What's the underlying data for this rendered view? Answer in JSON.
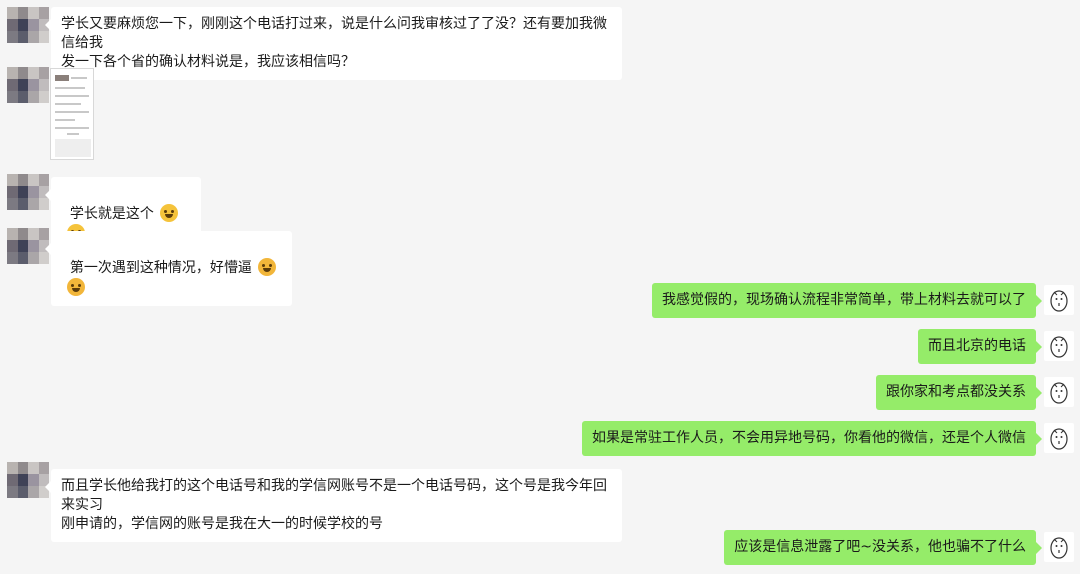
{
  "messages": [
    {
      "side": "in",
      "text": "学长又要麻烦您一下，刚刚这个电话打过来，说是什么问我审核过了了没？还有要加我微信给我\n发一下各个省的确认材料说是，我应该相信吗？"
    },
    {
      "side": "in",
      "type": "image"
    },
    {
      "side": "in",
      "text": "学长就是这个",
      "emoji": [
        "laugh-cry-emoji",
        "laugh-cry-emoji"
      ]
    },
    {
      "side": "in",
      "text": "第一次遇到这种情况，好懵逼",
      "emoji": [
        "facepalm-emoji",
        "facepalm-emoji"
      ]
    },
    {
      "side": "out",
      "text": "我感觉假的，现场确认流程非常简单，带上材料去就可以了"
    },
    {
      "side": "out",
      "text": "而且北京的电话"
    },
    {
      "side": "out",
      "text": "跟你家和考点都没关系"
    },
    {
      "side": "out",
      "text": "如果是常驻工作人员，不会用异地号码，你看他的微信，还是个人微信"
    },
    {
      "side": "in",
      "text": "而且学长他给我打的这个电话号和我的学信网账号不是一个电话号码，这个号是我今年回来实习\n刚申请的，学信网的账号是我在大一的时候学校的号"
    },
    {
      "side": "out",
      "text": "应该是信息泄露了吧~没关系，他也骗不了什么"
    }
  ],
  "colors": {
    "background": "#f5f5f5",
    "incoming": "#ffffff",
    "outgoing": "#95ec69"
  }
}
